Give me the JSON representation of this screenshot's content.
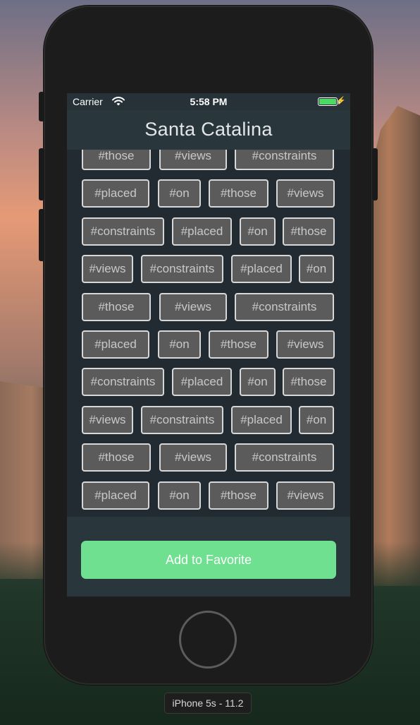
{
  "status_bar": {
    "carrier": "Carrier",
    "time": "5:58 PM"
  },
  "nav": {
    "title": "Santa Catalina"
  },
  "tag_rows": [
    [
      "#those",
      "#views",
      "#constraints"
    ],
    [
      "#placed",
      "#on",
      "#those",
      "#views"
    ],
    [
      "#constraints",
      "#placed",
      "#on",
      "#those"
    ],
    [
      "#views",
      "#constraints",
      "#placed",
      "#on"
    ],
    [
      "#those",
      "#views",
      "#constraints"
    ],
    [
      "#placed",
      "#on",
      "#those",
      "#views"
    ],
    [
      "#constraints",
      "#placed",
      "#on",
      "#those"
    ],
    [
      "#views",
      "#constraints",
      "#placed",
      "#on"
    ],
    [
      "#those",
      "#views",
      "#constraints"
    ],
    [
      "#placed",
      "#on",
      "#those",
      "#views"
    ]
  ],
  "footer": {
    "button_label": "Add to Favorite"
  },
  "simulator": {
    "device_label": "iPhone 5s - 11.2"
  },
  "colors": {
    "accent_green": "#6fe08f",
    "nav_background": "#29363c",
    "tag_fill": "#5b5b5b",
    "tag_border": "#d7d7d7"
  },
  "icons": [
    "wifi-icon",
    "battery-icon",
    "charging-bolt-icon"
  ]
}
